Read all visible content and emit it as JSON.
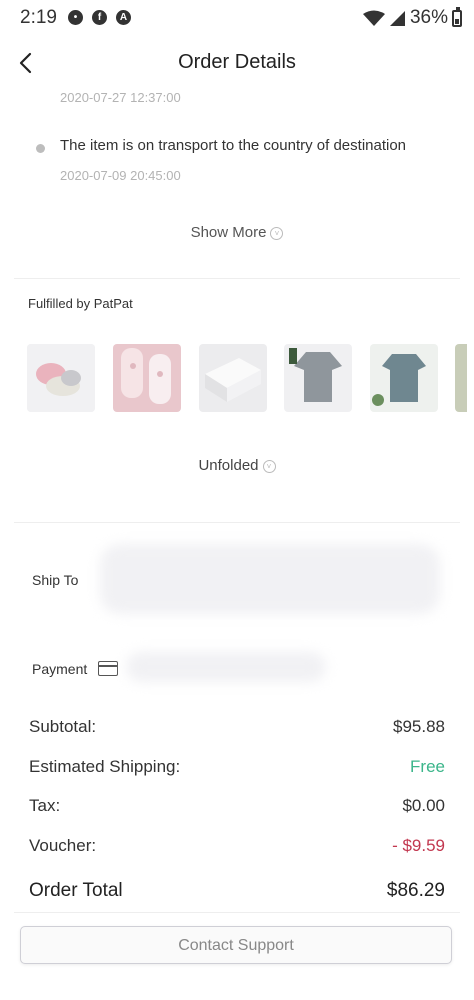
{
  "status_bar": {
    "time": "2:19",
    "battery_percent": "36%",
    "icons": [
      "chat-icon",
      "facebook-icon",
      "app-icon",
      "wifi-icon",
      "signal-icon",
      "battery-icon"
    ]
  },
  "header": {
    "title": "Order Details"
  },
  "tracking": {
    "previous_date": "2020-07-27 12:37:00",
    "event_text": "The item is on transport to the country of destination",
    "event_date": "2020-07-09 20:45:00",
    "show_more_label": "Show More"
  },
  "fulfilled": {
    "label": "Fulfilled by PatPat",
    "unfolded_label": "Unfolded"
  },
  "shipping": {
    "ship_to_label": "Ship To"
  },
  "payment": {
    "label": "Payment"
  },
  "summary": {
    "subtotal_label": "Subtotal:",
    "subtotal_value": "$95.88",
    "shipping_label": "Estimated Shipping:",
    "shipping_value": "Free",
    "tax_label": "Tax:",
    "tax_value": "$0.00",
    "voucher_label": "Voucher:",
    "voucher_value": "- $9.59",
    "total_label": "Order Total",
    "total_value": "$86.29"
  },
  "contact_button": {
    "label": "Contact Support"
  },
  "colors": {
    "free": "#3bb58a",
    "discount": "#c2374f"
  }
}
